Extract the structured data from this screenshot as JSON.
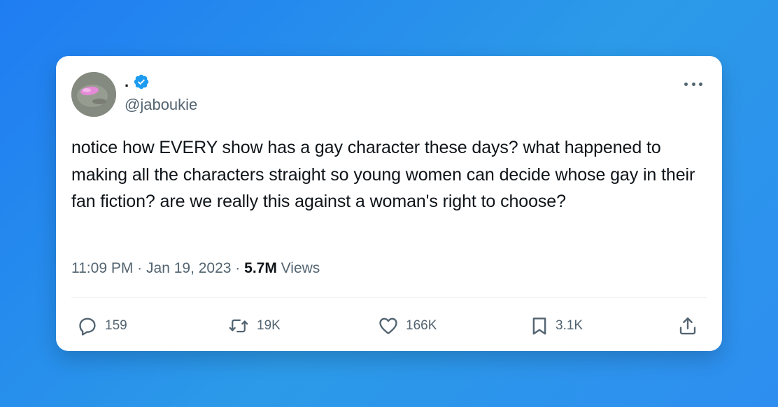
{
  "tweet": {
    "display_name": ".",
    "handle": "@jaboukie",
    "text": "notice how EVERY show has a gay character these days? what happened to making all the characters straight so young women can decide whose gay in their fan fiction? are we really this against a woman's right to choose?",
    "time": "11:09 PM",
    "date": "Jan 19, 2023",
    "separator": "·",
    "views_count": "5.7M",
    "views_label": "Views"
  },
  "actions": {
    "replies": "159",
    "retweets": "19K",
    "likes": "166K",
    "bookmarks": "3.1K"
  },
  "colors": {
    "verified": "#1d9bf0",
    "text": "#0f1419",
    "muted": "#536471"
  },
  "icons": {
    "avatar": "avatar-image",
    "verified": "verified-badge-icon",
    "more": "more-options-icon",
    "reply": "reply-icon",
    "retweet": "retweet-icon",
    "like": "heart-icon",
    "bookmark": "bookmark-icon",
    "share": "share-icon"
  }
}
